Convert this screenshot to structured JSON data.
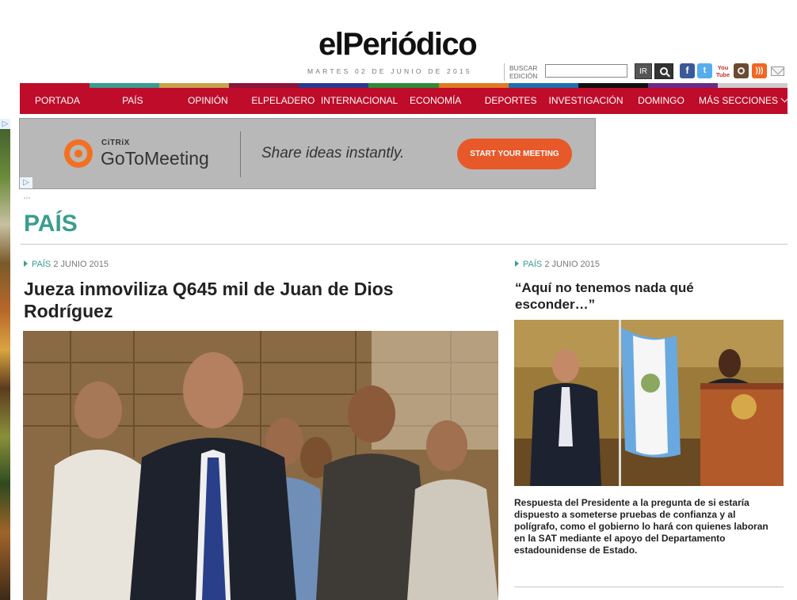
{
  "header": {
    "logo_text": "elPeriódico",
    "date": "MARTES 02 DE JUNIO DE 2015",
    "search_label": "BUSCAR\nEDICIÓN",
    "search_placeholder": "",
    "go_label": "IR",
    "social_icons": [
      "facebook-icon",
      "twitter-icon",
      "youtube-icon",
      "instagram-icon",
      "rss-icon",
      "mail-icon"
    ],
    "youtube_label": "You\nTube"
  },
  "color_strip": [
    "#be0c2a",
    "#3a9d8f",
    "#c6a24b",
    "#8a1538",
    "#2a3a8f",
    "#2e8b3a",
    "#e07a1f",
    "#1f6fb3",
    "#111111",
    "#6a2a8a",
    "#cccccc"
  ],
  "nav": {
    "items": [
      "PORTADA",
      "PAÍS",
      "OPINIÓN",
      "ELPELADERO",
      "INTERNACIONAL",
      "ECONOMÍA",
      "DEPORTES",
      "INVESTIGACIÓN",
      "DOMINGO",
      "MÁS SECCIONES"
    ]
  },
  "banner_ad": {
    "brand_small": "CiTRiX",
    "brand_name": "GoToMeeting",
    "tagline": "Share ideas instantly.",
    "cta": "START YOUR MEETING",
    "adchoices": "▷"
  },
  "section": {
    "title": "PAÍS"
  },
  "main_article": {
    "category": "PAÍS",
    "date": "2 JUNIO 2015",
    "headline": "Jueza inmoviliza Q645 mil de Juan de Dios Rodríguez"
  },
  "side_article": {
    "category": "PAÍS",
    "date": "2 JUNIO 2015",
    "headline": "“Aquí no tenemos nada qué esconder…”",
    "caption": "Respuesta del Presidente a la pregunta de si estaría dispuesto a someterse pruebas de confianza y al polígrafo, como el gobierno lo hará con quienes laboran en la SAT mediante el apoyo del Departamento estadounidense de Estado."
  },
  "colors": {
    "nav_red": "#be0c2a",
    "section_teal": "#3a9d8f",
    "cta_orange": "#e8592a"
  }
}
